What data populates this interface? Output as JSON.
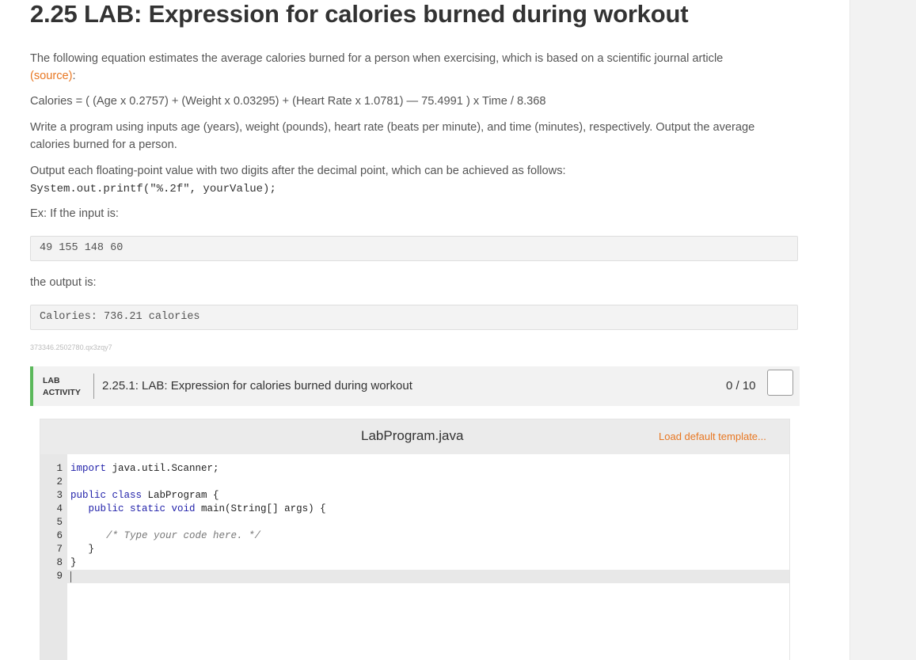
{
  "page": {
    "title": "2.25 LAB: Expression for calories burned during workout",
    "intro_text": "The following equation estimates the average calories burned for a person when exercising, which is based on a scientific journal article",
    "source_link": "(source)",
    "source_colon": ":",
    "equation": "Calories = ( (Age x 0.2757) + (Weight x 0.03295) + (Heart Rate x 1.0781) — 75.4991 ) x Time / 8.368",
    "instructions": "Write a program using inputs age (years), weight (pounds), heart rate (beats per minute), and time (minutes), respectively. Output the average calories burned for a person.",
    "format_note": "Output each floating-point value with two digits after the decimal point, which can be achieved as follows:",
    "printf_code": "System.out.printf(\"%.2f\", yourValue);",
    "example_label": "Ex: If the input is:",
    "example_input": "49 155 148 60",
    "output_label": "the output is:",
    "example_output": "Calories: 736.21 calories",
    "activity_id": "373346.2502780.qx3zqy7"
  },
  "lab": {
    "tag_line1": "LAB",
    "tag_line2": "ACTIVITY",
    "title": "2.25.1: LAB: Expression for calories burned during workout",
    "score": "0 / 10"
  },
  "ide": {
    "file_name": "LabProgram.java",
    "load_template": "Load default template...",
    "line_numbers": [
      "1",
      "2",
      "3",
      "4",
      "5",
      "6",
      "7",
      "8",
      "9"
    ],
    "code": {
      "l1_kw": "import",
      "l1_rest": " java.util.Scanner;",
      "l3_kw": "public class",
      "l3_rest": " LabProgram {",
      "l4_pre": "   ",
      "l4_kw": "public static void",
      "l4_rest": " main(String[] args) {",
      "l6": "      /* Type your code here. */",
      "l7": "   }",
      "l8": "}"
    }
  },
  "colors": {
    "accent_orange": "#e87722",
    "lab_green": "#5bb85b"
  }
}
